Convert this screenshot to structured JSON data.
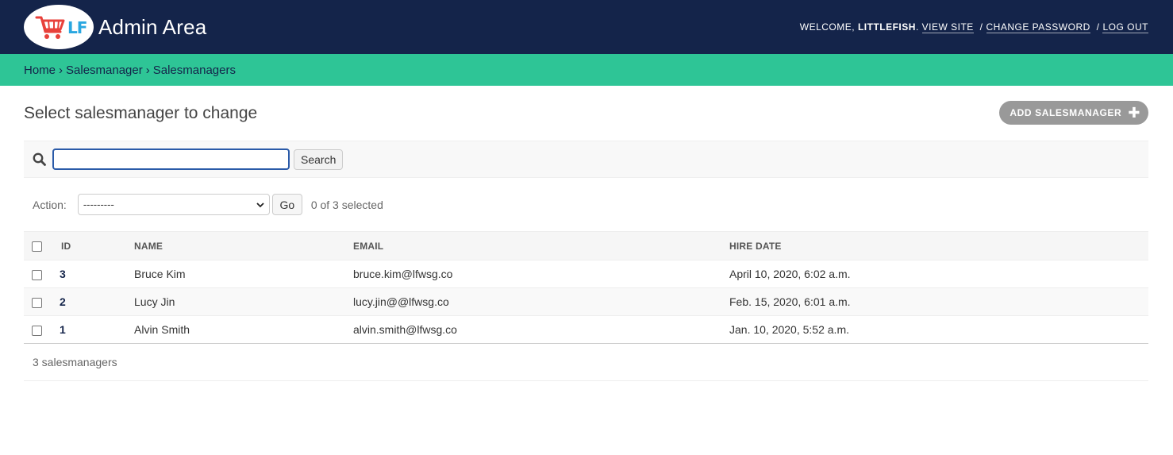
{
  "header": {
    "logo_text": "LF",
    "site_title": "Admin Area",
    "welcome": "Welcome, ",
    "username": "LittleFish",
    "period": ".",
    "view_site": "View site",
    "change_password": "Change password",
    "log_out": "Log out",
    "separator": "/",
    "bg_color": "#14244a"
  },
  "breadcrumbs": {
    "items": [
      "Home",
      "Salesmanager",
      "Salesmanagers"
    ],
    "separator": "›",
    "bg_color": "#2ec596"
  },
  "page": {
    "title": "Select salesmanager to change",
    "add_button": "Add salesmanager"
  },
  "search": {
    "value": "",
    "button": "Search"
  },
  "actions": {
    "label": "Action:",
    "selected_option": "---------",
    "go": "Go",
    "selected_count": "0 of 3 selected"
  },
  "table": {
    "columns": [
      "ID",
      "Name",
      "Email",
      "Hire date"
    ],
    "rows": [
      {
        "id": "3",
        "name": "Bruce Kim",
        "email": "bruce.kim@lfwsg.co",
        "hire_date": "April 10, 2020, 6:02 a.m."
      },
      {
        "id": "2",
        "name": "Lucy Jin",
        "email": "lucy.jin@@lfwsg.co",
        "hire_date": "Feb. 15, 2020, 6:01 a.m."
      },
      {
        "id": "1",
        "name": "Alvin Smith",
        "email": "alvin.smith@lfwsg.co",
        "hire_date": "Jan. 10, 2020, 5:52 a.m."
      }
    ]
  },
  "paginator": {
    "count": "3 salesmanagers"
  }
}
